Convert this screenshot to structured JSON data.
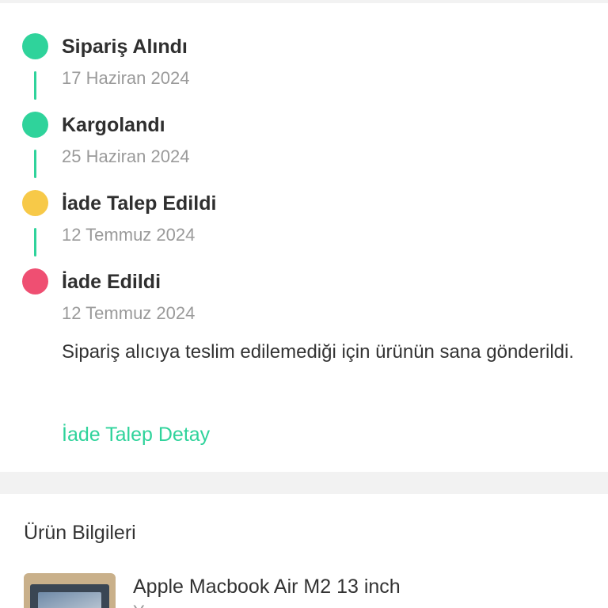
{
  "timeline": {
    "steps": [
      {
        "title": "Sipariş Alındı",
        "date": "17 Haziran 2024",
        "status_color": "#2fd39b"
      },
      {
        "title": "Kargolandı",
        "date": "25 Haziran 2024",
        "status_color": "#2fd39b"
      },
      {
        "title": "İade Talep Edildi",
        "date": "12 Temmuz 2024",
        "status_color": "#f7c948"
      },
      {
        "title": "İade Edildi",
        "date": "12 Temmuz 2024",
        "status_color": "#ef4f72"
      }
    ],
    "connector_color": "#2fd39b",
    "return_description": "Sipariş alıcıya teslim edilemediği için ürünün sana gönderildi.",
    "return_link_label": "İade Talep Detay"
  },
  "product_section": {
    "title": "Ürün Bilgileri",
    "product": {
      "name": "Apple Macbook Air M2 13 inch",
      "variant": "Y..."
    }
  },
  "colors": {
    "accent": "#2fd39b",
    "pending": "#f7c948",
    "returned": "#ef4f72"
  }
}
